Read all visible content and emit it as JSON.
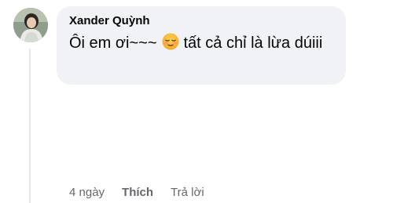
{
  "comment": {
    "author": "Xander Quỳnh",
    "text_before_emoji": "Ôi em ơi~~~",
    "emoji": "relieved-face",
    "text_after_emoji": "tất cả chỉ là lừa dúiii",
    "timestamp": "4 ngày",
    "like_label": "Thích",
    "reply_label": "Trả lời"
  },
  "colors": {
    "bubble_bg": "#f0f2f5",
    "name_text": "#050505",
    "meta_text": "#65676b",
    "thread_line": "#e4e6eb"
  }
}
